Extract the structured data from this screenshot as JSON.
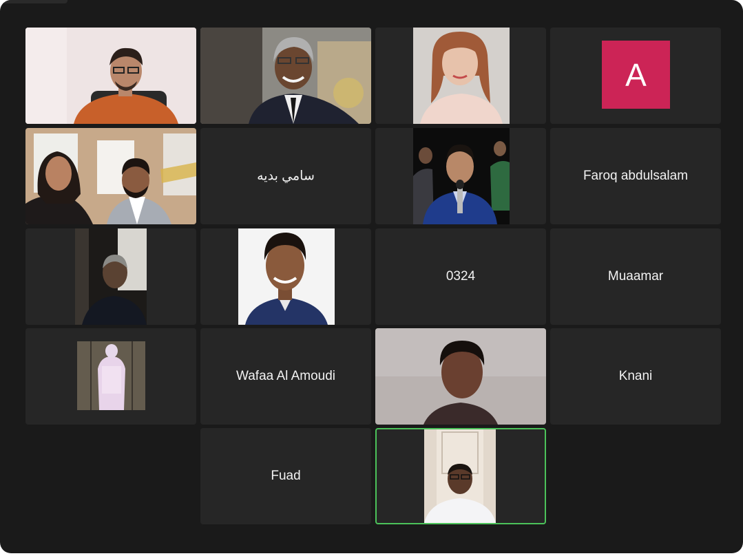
{
  "meeting": {
    "avatar_color": "#cc2456",
    "active_speaker_border": "#4cc35a",
    "participants": [
      {
        "kind": "video",
        "subject": "man in orange shirt at desk"
      },
      {
        "kind": "video",
        "subject": "man in suit smiling"
      },
      {
        "kind": "video",
        "subject": "woman with long hair"
      },
      {
        "kind": "avatar",
        "initial": "A"
      },
      {
        "kind": "video",
        "subject": "woman and man in classroom"
      },
      {
        "kind": "name",
        "name": "سامي بديه"
      },
      {
        "kind": "video",
        "subject": "man in blue suit at microphone"
      },
      {
        "kind": "name",
        "name": "Faroq abdulsalam"
      },
      {
        "kind": "video",
        "subject": "man in dark room"
      },
      {
        "kind": "video",
        "subject": "young man portrait"
      },
      {
        "kind": "name",
        "name": "0324"
      },
      {
        "kind": "name",
        "name": "Muaamar"
      },
      {
        "kind": "video",
        "subject": "figure in white thobe"
      },
      {
        "kind": "name",
        "name": "Wafaa Al Amoudi"
      },
      {
        "kind": "video",
        "subject": "young man against light wall"
      },
      {
        "kind": "name",
        "name": "Knani"
      },
      {
        "kind": "name",
        "name": "Fuad"
      },
      {
        "kind": "video",
        "subject": "man with glasses in white",
        "active": true
      }
    ]
  }
}
